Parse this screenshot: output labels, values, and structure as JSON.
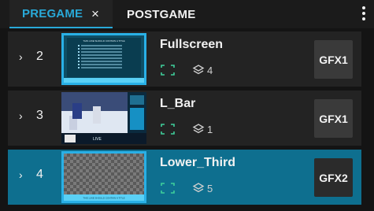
{
  "tabs": [
    {
      "label": "PREGAME",
      "active": true,
      "close_icon": "×"
    },
    {
      "label": "POSTGAME",
      "active": false
    }
  ],
  "menu_icon": "kebab-menu-icon",
  "rows": [
    {
      "number": "2",
      "name": "Fullscreen",
      "layer_count": "4",
      "output": "GFX1",
      "active": false,
      "thumbnail": "fullscreen-graphic",
      "thumbnail_text": "THIS LINE SHOULD CONTAIN A TITLE"
    },
    {
      "number": "3",
      "name": "L_Bar",
      "layer_count": "1",
      "output": "GFX1",
      "active": false,
      "thumbnail": "hockey-l-bar",
      "thumbnail_text": "LIVE"
    },
    {
      "number": "4",
      "name": "Lower_Third",
      "layer_count": "5",
      "output": "GFX2",
      "active": true,
      "thumbnail": "transparent-lower-third",
      "thumbnail_text": "THIS LINE SHOULD CONTAIN A TITLE"
    }
  ],
  "colors": {
    "accent": "#29a9d8",
    "active_row": "#0e6f8f",
    "row_bg": "#232323",
    "page_bg": "#141414",
    "bracket": "#3fcf9b"
  }
}
